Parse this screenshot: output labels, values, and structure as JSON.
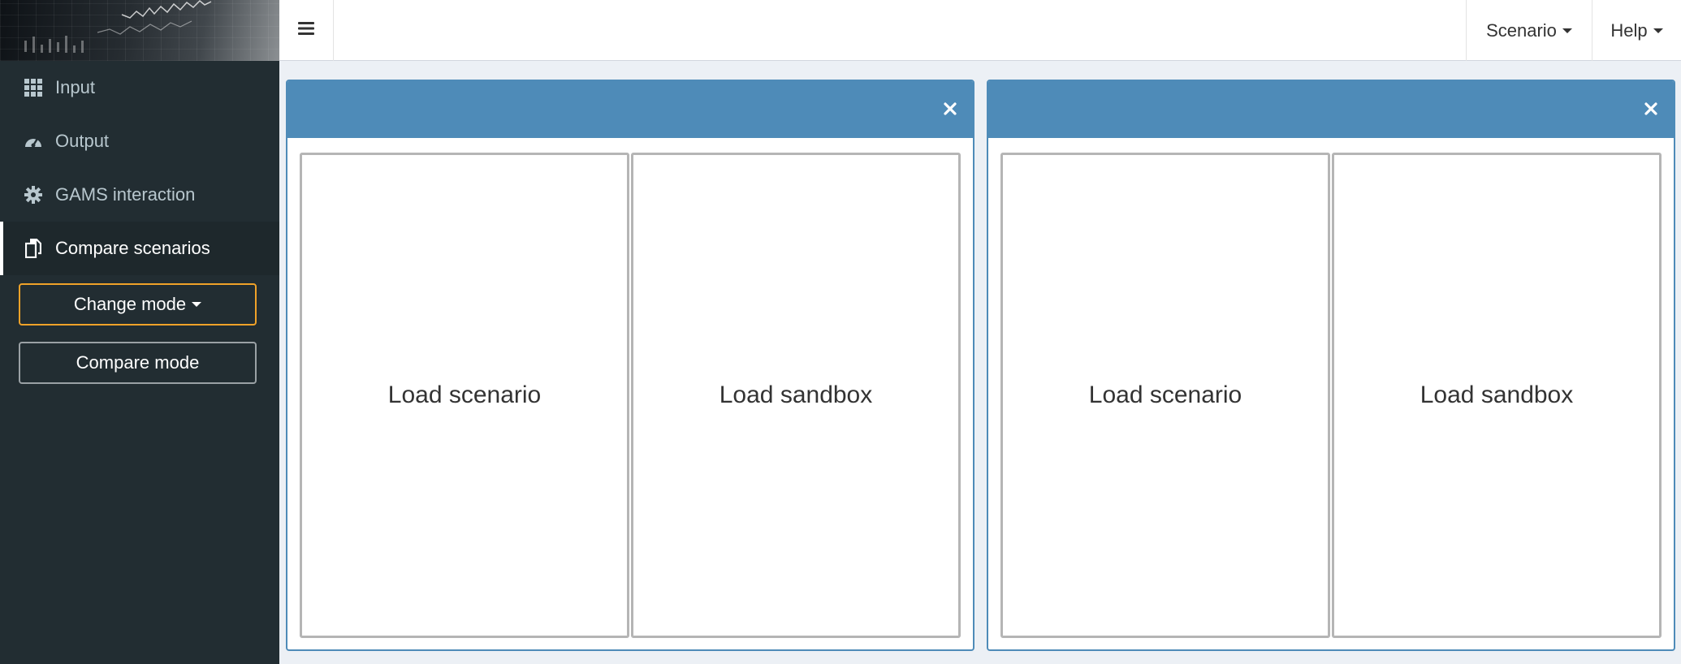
{
  "sidebar": {
    "items": [
      {
        "label": "Input",
        "icon": "grid-icon"
      },
      {
        "label": "Output",
        "icon": "dashboard-icon"
      },
      {
        "label": "GAMS interaction",
        "icon": "gear-icon"
      },
      {
        "label": "Compare scenarios",
        "icon": "copy-icon",
        "active": true
      }
    ],
    "change_mode_label": "Change mode",
    "compare_mode_label": "Compare mode"
  },
  "header": {
    "menu_icon": "hamburger-icon",
    "scenario_label": "Scenario",
    "help_label": "Help"
  },
  "panels": [
    {
      "load_scenario_label": "Load scenario",
      "load_sandbox_label": "Load sandbox"
    },
    {
      "load_scenario_label": "Load scenario",
      "load_sandbox_label": "Load sandbox"
    }
  ],
  "colors": {
    "sidebar_bg": "#222d32",
    "panel_header": "#4e8bb8",
    "change_mode_border": "#f0a229",
    "content_bg": "#ecf0f5"
  }
}
